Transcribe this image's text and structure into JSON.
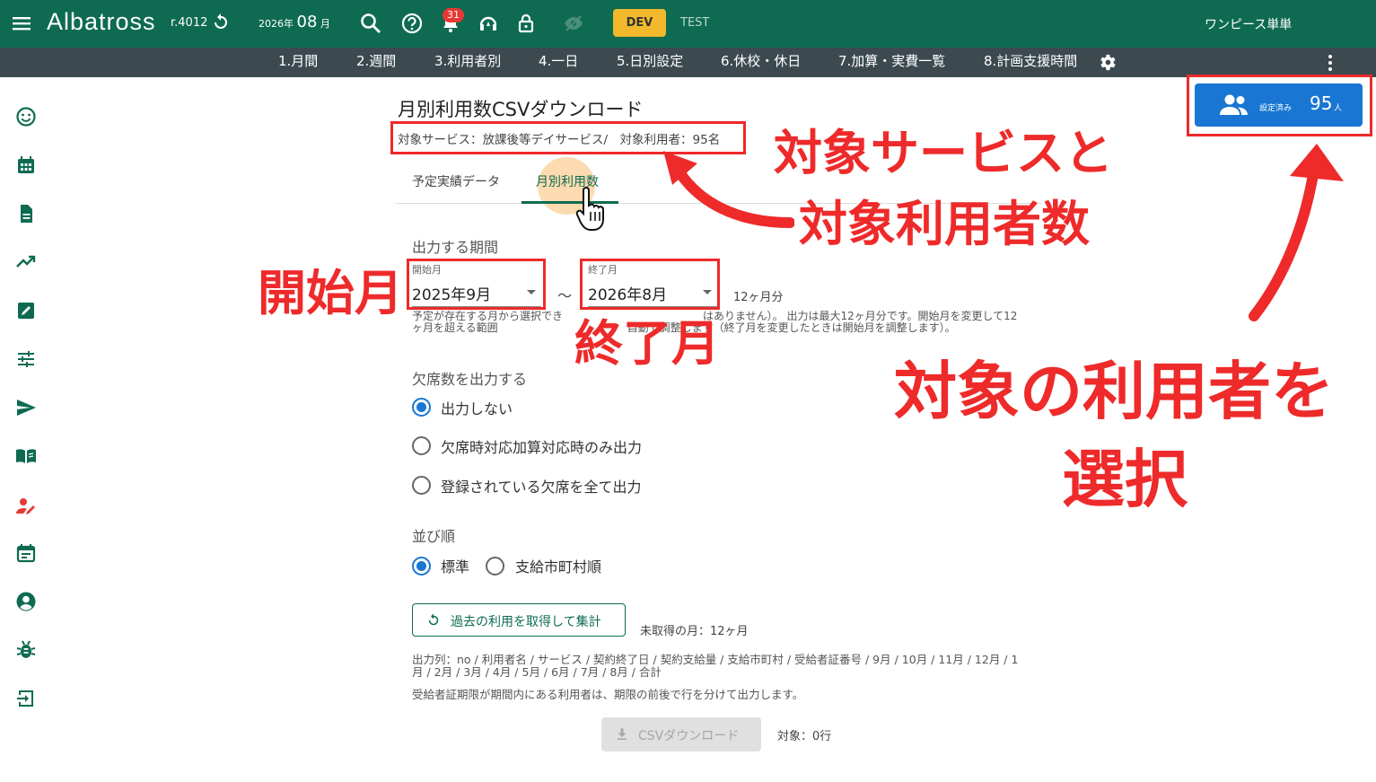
{
  "header": {
    "brand": "Albatross",
    "revision": "r.4012",
    "period_year": "2026年",
    "period_month": "08",
    "period_unit": "月",
    "notification_count": "31",
    "dev_label": "DEV",
    "test_label": "TEST",
    "facility_name": "ワンピース単単",
    "bg_color": "#0e6b51"
  },
  "nav": {
    "items": [
      "1.月間",
      "2.週間",
      "3.利用者別",
      "4.一日",
      "5.日別設定",
      "6.休校・休日",
      "7.加算・実費一覧",
      "8.計画支援時間"
    ]
  },
  "sidebar": {
    "icons": [
      "smile-icon",
      "calendar-grid-icon",
      "document-icon",
      "trending-icon",
      "edit-box-icon",
      "tune-icon",
      "send-icon",
      "book-icon",
      "user-edit-icon",
      "event-icon",
      "account-circle-icon",
      "bug-icon",
      "login-icon"
    ]
  },
  "page": {
    "title": "月別利用数CSVダウンロード",
    "service_text": "対象サービス：放課後等デイサービス/　対象利用者：95名",
    "tabs": [
      "予定実績データ",
      "月別利用数"
    ],
    "active_tab": "月別利用数",
    "period_label": "出力する期間",
    "start_label": "開始月",
    "start_value": "2025年9月",
    "end_label": "終了月",
    "end_value": "2026年8月",
    "tilde": "～",
    "months_count": "12ヶ月分",
    "help_text": "予定が存在する月から選択でき　　　　　　　　　　　　　はありません）。 出力は最大12ヶ月分です。開始月を変更して12ヶ月を超える範囲　　　　　　　　　　　　自動で調整します（終了月を変更したときは開始月を調整します）。",
    "absence_label": "欠席数を出力する",
    "absence_options": [
      "出力しない",
      "欠席時対応加算対応時のみ出力",
      "登録されている欠席を全て出力"
    ],
    "absence_selected": "出力しない",
    "sort_label": "並び順",
    "sort_options": [
      "標準",
      "支給市町村順"
    ],
    "sort_selected": "標準",
    "fetch_button": "過去の利用を取得して集計",
    "unfetched_text": "未取得の月：12ヶ月",
    "columns_text": "出力列：no / 利用者名 / サービス / 契約終了日 / 契約支給量 / 支給市町村 / 受給者証番号 / 9月 / 10月 / 11月 / 12月 / 1月 / 2月 / 3月 / 4月 / 5月 / 6月 / 7月 / 8月 / 合計",
    "columns_note": "受給者証期限が期間内にある利用者は、期限の前後で行を分けて出力します。",
    "csv_button": "CSVダウンロード",
    "target_rows": "対象：0行",
    "users_button_label": "設定済み",
    "users_count": "95",
    "users_unit": "人"
  },
  "annotations": {
    "service_users": [
      "対象サービスと",
      "対象利用者数"
    ],
    "start_month": "開始月",
    "end_month": "終了月",
    "select_users": [
      "対象の利用者を",
      "選択"
    ],
    "color": "#ee2a2a"
  }
}
